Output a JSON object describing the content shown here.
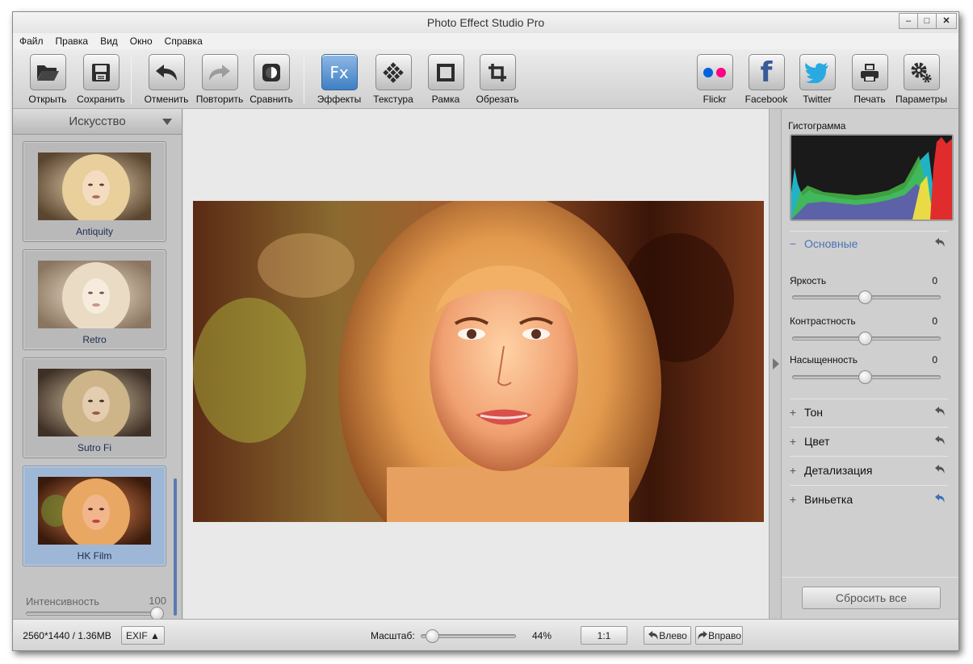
{
  "window": {
    "title": "Photo Effect Studio Pro",
    "controls": [
      "–",
      "□",
      "✕"
    ]
  },
  "menu": [
    "Файл",
    "Правка",
    "Вид",
    "Окно",
    "Справка"
  ],
  "toolbar": {
    "open": "Открыть",
    "save": "Сохранить",
    "undo": "Отменить",
    "redo": "Повторить",
    "compare": "Сравнить",
    "effects": "Эффекты",
    "effects_icon_text": "Fx",
    "texture": "Текстура",
    "frame": "Рамка",
    "crop": "Обрезать",
    "flickr": "Flickr",
    "facebook": "Facebook",
    "twitter": "Twitter",
    "print": "Печать",
    "settings": "Параметры"
  },
  "effects_panel": {
    "category": "Искусство",
    "items": [
      {
        "name": "Antiquity"
      },
      {
        "name": "Retro"
      },
      {
        "name": "Sutro Fi"
      },
      {
        "name": "HK Film",
        "selected": true
      }
    ],
    "intensity_label": "Интенсивность",
    "intensity_value": "100"
  },
  "right_panel": {
    "histogram_label": "Гистограмма",
    "basic": {
      "title": "Основные",
      "sign": "−",
      "brightness_label": "Яркость",
      "brightness_value": "0",
      "contrast_label": "Контрастность",
      "contrast_value": "0",
      "saturation_label": "Насыщенность",
      "saturation_value": "0"
    },
    "sections": [
      {
        "sign": "+",
        "title": "Тон"
      },
      {
        "sign": "+",
        "title": "Цвет"
      },
      {
        "sign": "+",
        "title": "Детализация"
      },
      {
        "sign": "+",
        "title": "Виньетка"
      }
    ],
    "reset_label": "Сбросить все"
  },
  "status": {
    "image_info": "2560*1440 / 1.36MB",
    "exif_label": "EXIF ▲",
    "zoom_label": "Масштаб:",
    "zoom_value": "44%",
    "one_to_one": "1:1",
    "rotate_left": "Влево",
    "rotate_right": "Вправо"
  },
  "colors": {
    "accent": "#4b74b5",
    "selected_item": "#9fb7d6",
    "flickr_blue": "#0063dc",
    "flickr_pink": "#ff0084",
    "facebook": "#3b5998",
    "twitter": "#29a9e1"
  }
}
